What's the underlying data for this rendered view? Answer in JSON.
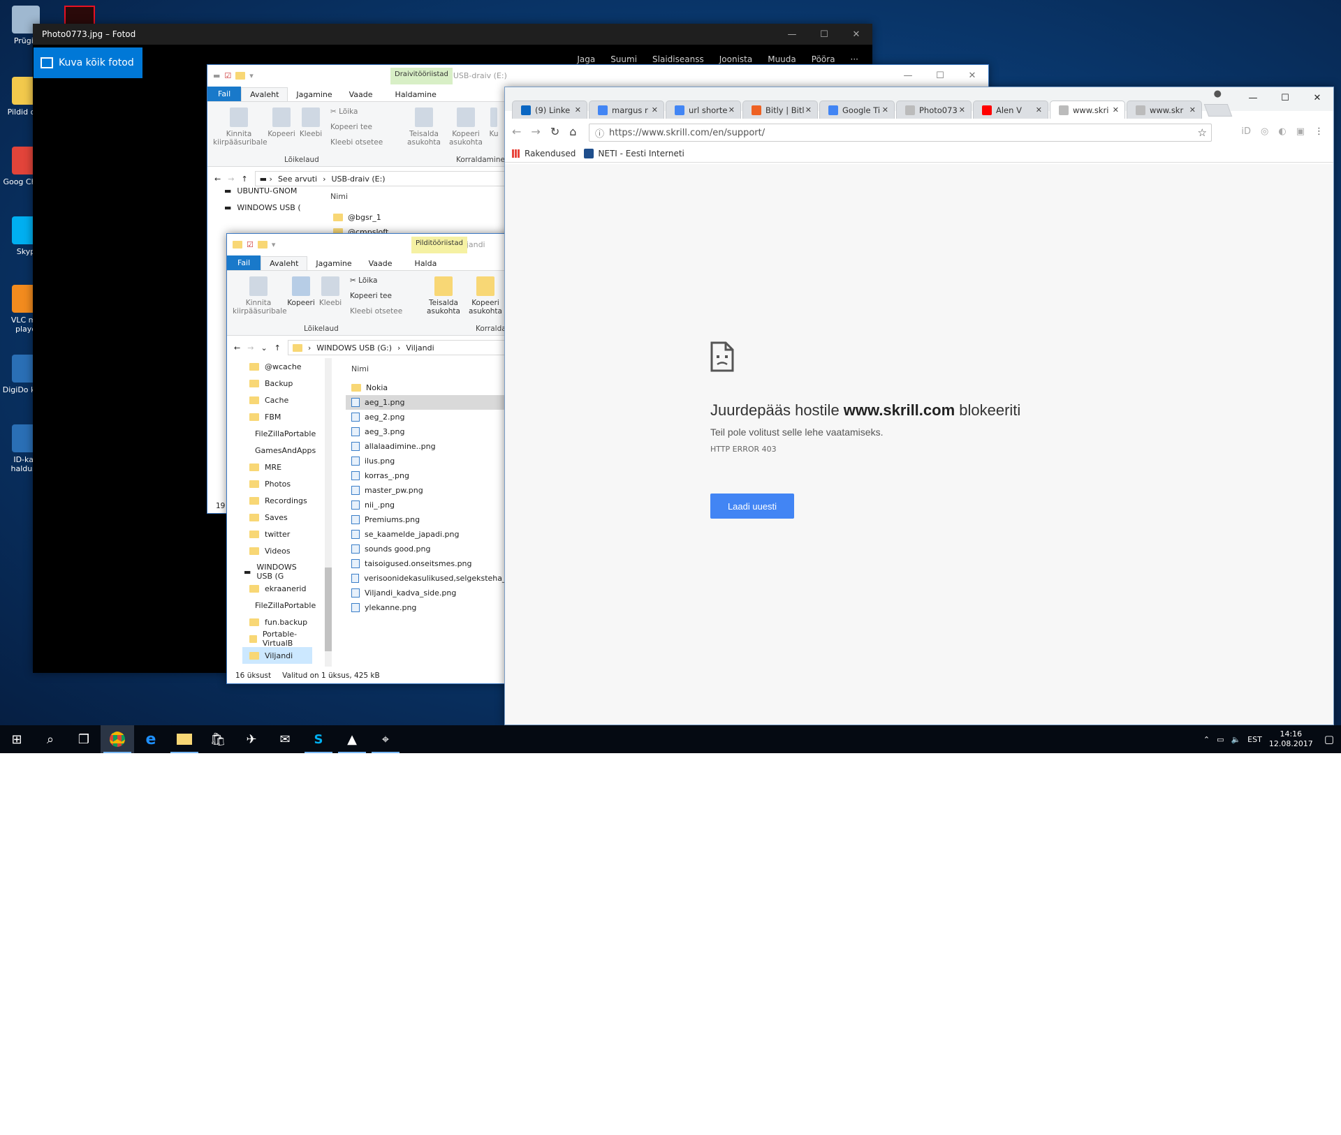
{
  "desktop": {
    "icons": [
      {
        "label": "Prügik",
        "color": "#9fb8d0"
      },
      {
        "label": "Pildid otsi",
        "color": "#f2c94c"
      },
      {
        "label": "Goog Chron",
        "color": "#e2443a"
      },
      {
        "label": "Skyp",
        "color": "#00aff0"
      },
      {
        "label": "VLC me playe",
        "color": "#f28b1e"
      },
      {
        "label": "DigiDo klien",
        "color": "#2a6fb5"
      },
      {
        "label": "ID-kaa haldusv",
        "color": "#2a6fb5"
      }
    ]
  },
  "photos": {
    "title": "Photo0773.jpg – Fotod",
    "show_all": "Kuva kõik fotod",
    "tools": [
      "Jaga",
      "Suumi",
      "Slaidiseanss",
      "Joonista",
      "Muuda",
      "Pööra",
      "···"
    ]
  },
  "explorer1": {
    "title": "USB-draiv (E:)",
    "context_tab": "Draivitööriistad",
    "tabs": [
      "Fail",
      "Avaleht",
      "Jagamine",
      "Vaade",
      "Haldamine"
    ],
    "ribbon": {
      "pin": "Kinnita kiirpääsuribale",
      "copy": "Kopeeri",
      "paste": "Kleebi",
      "cut": "Lõika",
      "copy_path": "Kopeeri tee",
      "paste_shortcut": "Kleebi otsetee",
      "move": "Teisalda asukohta",
      "copyto": "Kopeeri asukohta",
      "more": "Ku",
      "group1": "Lõikelaud",
      "group2": "Korraldamine"
    },
    "path": [
      "See arvuti",
      "USB-draiv (E:)"
    ],
    "nav": [
      "UBUNTU-GNOM",
      "WINDOWS USB ("
    ],
    "col_name": "Nimi",
    "files": [
      "@bgsr_1",
      "@cmpsloft"
    ],
    "status": "19"
  },
  "explorer2": {
    "title": "Viljandi",
    "context_tab": "Pilditööriistad",
    "tabs": [
      "Fail",
      "Avaleht",
      "Jagamine",
      "Vaade",
      "Halda"
    ],
    "ribbon": {
      "pin": "Kinnita kiirpääsuribale",
      "copy": "Kopeeri",
      "paste": "Kleebi",
      "cut": "Lõika",
      "copy_path": "Kopeeri tee",
      "paste_shortcut": "Kleebi otsetee",
      "move": "Teisalda asukohta",
      "copyto": "Kopeeri asukohta",
      "group1": "Lõikelaud",
      "group2": "Korraldamine"
    },
    "path": [
      "WINDOWS USB (G:)",
      "Viljandi"
    ],
    "nav": [
      "@wcache",
      "Backup",
      "Cache",
      "FBM",
      "FileZillaPortable",
      "GamesAndApps",
      "MRE",
      "Photos",
      "Recordings",
      "Saves",
      "twitter",
      "Videos"
    ],
    "nav_drive": "WINDOWS USB (G",
    "nav2": [
      "ekraanerid",
      "FileZillaPortable",
      "fun.backup",
      "Portable-VirtualB",
      "Viljandi"
    ],
    "col_name": "Nimi",
    "files": [
      "Nokia",
      "aeg_1.png",
      "aeg_2.png",
      "aeg_3.png",
      "allalaadimine..png",
      "ilus.png",
      "korras_.png",
      "master_pw.png",
      "nii_.png",
      "Premiums.png",
      "se_kaamelde_japadi.png",
      "sounds good.png",
      "taisoigused.onseitsmes.png",
      "verisoonidekasulikused,selgeksteha_.p",
      "Viljandi_kadva_side.png",
      "ylekanne.png"
    ],
    "status_count": "16 üksust",
    "status_sel": "Valitud on 1 üksus, 425 kB"
  },
  "chrome": {
    "tabs": [
      {
        "label": "(9) Linke",
        "color": "#0a66c2"
      },
      {
        "label": "margus r",
        "color": "#4285f4"
      },
      {
        "label": "url shorte",
        "color": "#4285f4"
      },
      {
        "label": "Bitly | Bitl",
        "color": "#ee6123"
      },
      {
        "label": "Google Ti",
        "color": "#4285f4"
      },
      {
        "label": "Photo073",
        "color": "#bbbbbb"
      },
      {
        "label": "Alen V",
        "color": "#ff0000"
      },
      {
        "label": "www.skri",
        "color": "#bbbbbb"
      },
      {
        "label": "www.skr",
        "color": "#bbbbbb"
      }
    ],
    "url": "https://www.skrill.com/en/support/",
    "bookmarks": [
      "Rakendused",
      "NETI - Eesti Interneti"
    ],
    "error_prefix": "Juurdepääs hostile ",
    "error_host": "www.skrill.com",
    "error_suffix": " blokeeriti",
    "error_sub": "Teil pole volitust selle lehe vaatamiseks.",
    "error_code": "HTTP ERROR 403",
    "reload": "Laadi uuesti"
  },
  "taskbar": {
    "lang": "EST",
    "time": "14:16",
    "date": "12.08.2017"
  }
}
